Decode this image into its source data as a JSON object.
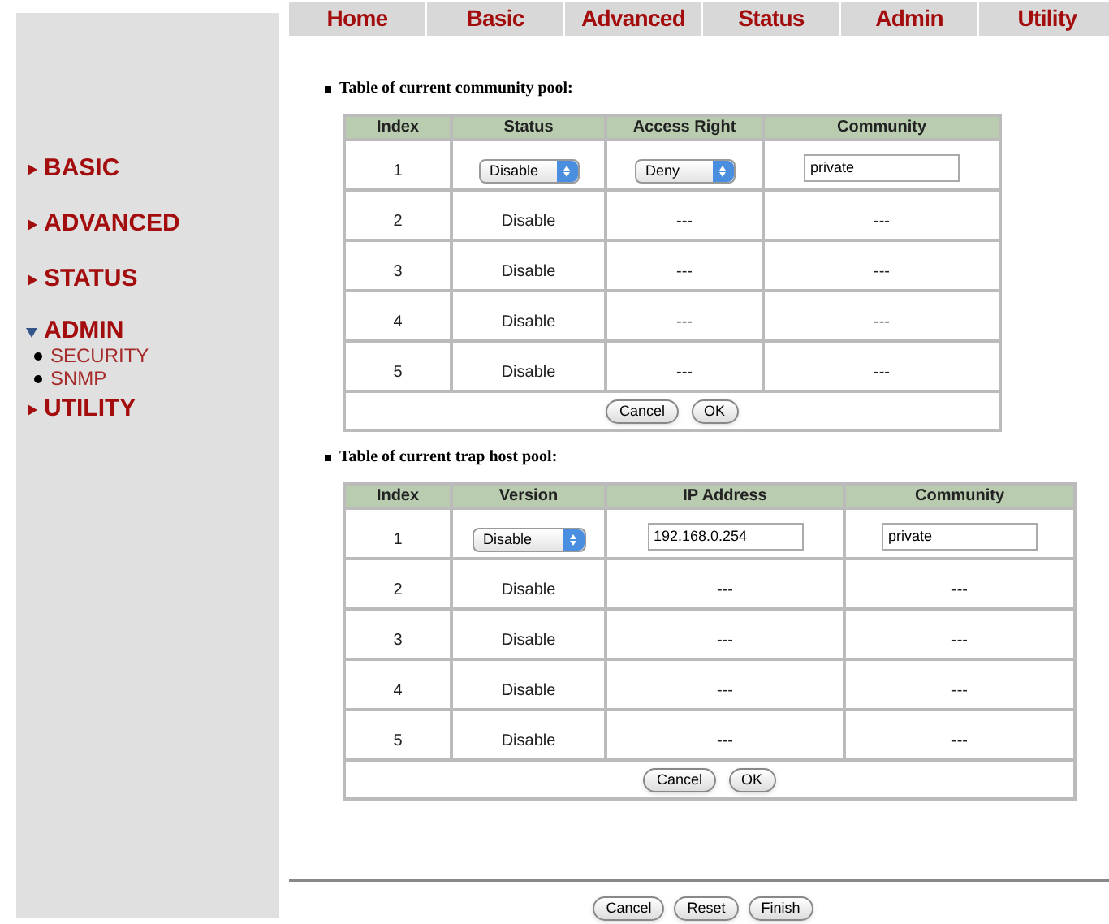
{
  "top_nav": [
    {
      "label": "Home"
    },
    {
      "label": "Basic"
    },
    {
      "label": "Advanced"
    },
    {
      "label": "Status"
    },
    {
      "label": "Admin"
    },
    {
      "label": "Utility"
    }
  ],
  "sidebar": {
    "items": [
      {
        "label": "BASIC",
        "expanded": false
      },
      {
        "label": "ADVANCED",
        "expanded": false
      },
      {
        "label": "STATUS",
        "expanded": false
      },
      {
        "label": "ADMIN",
        "expanded": true,
        "children": [
          {
            "label": "SECURITY"
          },
          {
            "label": "SNMP"
          }
        ]
      },
      {
        "label": "UTILITY",
        "expanded": false
      }
    ]
  },
  "sections": [
    {
      "heading": "Table of current community pool:",
      "columns": [
        "Index",
        "Status",
        "Access Right",
        "Community"
      ],
      "rows": [
        [
          {
            "kind": "text",
            "text": "1"
          },
          {
            "kind": "select",
            "value": "Disable"
          },
          {
            "kind": "select",
            "value": "Deny"
          },
          {
            "kind": "input",
            "value": "private"
          }
        ],
        [
          {
            "kind": "text",
            "text": "2"
          },
          {
            "kind": "text",
            "text": "Disable"
          },
          {
            "kind": "text",
            "text": "---"
          },
          {
            "kind": "text",
            "text": "---"
          }
        ],
        [
          {
            "kind": "text",
            "text": "3"
          },
          {
            "kind": "text",
            "text": "Disable"
          },
          {
            "kind": "text",
            "text": "---"
          },
          {
            "kind": "text",
            "text": "---"
          }
        ],
        [
          {
            "kind": "text",
            "text": "4"
          },
          {
            "kind": "text",
            "text": "Disable"
          },
          {
            "kind": "text",
            "text": "---"
          },
          {
            "kind": "text",
            "text": "---"
          }
        ],
        [
          {
            "kind": "text",
            "text": "5"
          },
          {
            "kind": "text",
            "text": "Disable"
          },
          {
            "kind": "text",
            "text": "---"
          },
          {
            "kind": "text",
            "text": "---"
          }
        ]
      ],
      "buttons": [
        "Cancel",
        "OK"
      ]
    },
    {
      "heading": "Table of current trap host pool:",
      "columns": [
        "Index",
        "Version",
        "IP Address",
        "Community"
      ],
      "rows": [
        [
          {
            "kind": "text",
            "text": "1"
          },
          {
            "kind": "select",
            "value": "Disable"
          },
          {
            "kind": "input",
            "value": "192.168.0.254"
          },
          {
            "kind": "input",
            "value": "private"
          }
        ],
        [
          {
            "kind": "text",
            "text": "2"
          },
          {
            "kind": "text",
            "text": "Disable"
          },
          {
            "kind": "text",
            "text": "---"
          },
          {
            "kind": "text",
            "text": "---"
          }
        ],
        [
          {
            "kind": "text",
            "text": "3"
          },
          {
            "kind": "text",
            "text": "Disable"
          },
          {
            "kind": "text",
            "text": "---"
          },
          {
            "kind": "text",
            "text": "---"
          }
        ],
        [
          {
            "kind": "text",
            "text": "4"
          },
          {
            "kind": "text",
            "text": "Disable"
          },
          {
            "kind": "text",
            "text": "---"
          },
          {
            "kind": "text",
            "text": "---"
          }
        ],
        [
          {
            "kind": "text",
            "text": "5"
          },
          {
            "kind": "text",
            "text": "Disable"
          },
          {
            "kind": "text",
            "text": "---"
          },
          {
            "kind": "text",
            "text": "---"
          }
        ]
      ],
      "buttons": [
        "Cancel",
        "OK"
      ]
    }
  ],
  "footer_buttons": [
    "Cancel",
    "Reset",
    "Finish"
  ]
}
